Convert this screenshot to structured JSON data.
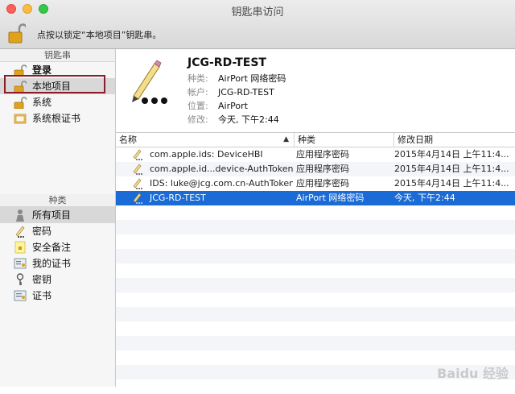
{
  "window": {
    "title": "钥匙串访问"
  },
  "toolbar": {
    "lock_hint": "点按以锁定“本地项目”钥匙串。"
  },
  "sidebar": {
    "keychains_header": "钥匙串",
    "keychains": [
      {
        "label": "登录",
        "icon": "lock-icon",
        "bold": true
      },
      {
        "label": "本地项目",
        "icon": "lock-icon",
        "selected": true
      },
      {
        "label": "系统",
        "icon": "lock-icon"
      },
      {
        "label": "系统根证书",
        "icon": "certificate-folder-icon"
      }
    ],
    "categories_header": "种类",
    "categories": [
      {
        "label": "所有项目",
        "icon": "all-items-icon",
        "selected": true
      },
      {
        "label": "密码",
        "icon": "password-icon"
      },
      {
        "label": "安全备注",
        "icon": "secure-note-icon"
      },
      {
        "label": "我的证书",
        "icon": "my-certificate-icon"
      },
      {
        "label": "密钥",
        "icon": "key-icon"
      },
      {
        "label": "证书",
        "icon": "certificate-icon"
      }
    ]
  },
  "detail": {
    "title": "JCG-RD-TEST",
    "rows": [
      {
        "label": "种类:",
        "value": "AirPort 网络密码"
      },
      {
        "label": "帐户:",
        "value": "JCG-RD-TEST"
      },
      {
        "label": "位置:",
        "value": "AirPort"
      },
      {
        "label": "修改:",
        "value": "今天, 下午2:44"
      }
    ]
  },
  "table": {
    "columns": [
      "名称",
      "种类",
      "修改日期"
    ],
    "rows": [
      {
        "name": "com.apple.ids: DeviceHBI",
        "kind": "应用程序密码",
        "date": "2015年4月14日 上午11:4..."
      },
      {
        "name": "com.apple.id...device-AuthToken",
        "kind": "应用程序密码",
        "date": "2015年4月14日 上午11:4..."
      },
      {
        "name": "IDS: luke@jcg.com.cn-AuthToken",
        "kind": "应用程序密码",
        "date": "2015年4月14日 上午11:4..."
      },
      {
        "name": "JCG-RD-TEST",
        "kind": "AirPort 网络密码",
        "date": "今天, 下午2:44",
        "selected": true
      }
    ]
  },
  "watermark": "Baidu 经验"
}
